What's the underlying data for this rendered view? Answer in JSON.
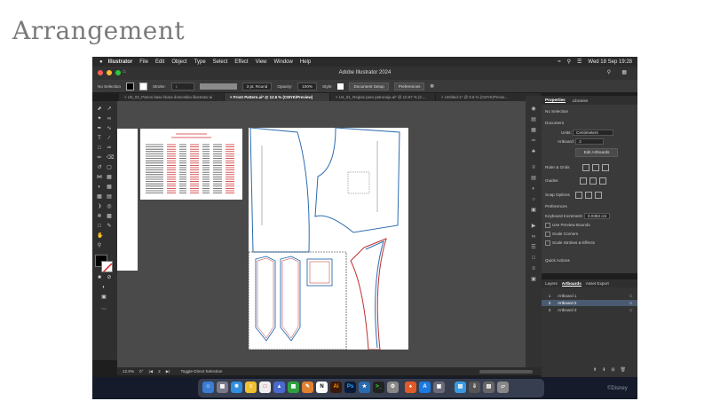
{
  "slide": {
    "title": "Arrangement"
  },
  "menubar": {
    "apple": "",
    "items": [
      "Illustrator",
      "File",
      "Edit",
      "Object",
      "Type",
      "Select",
      "Effect",
      "View",
      "Window",
      "Help"
    ],
    "datetime": "Wed 18 Sep 19:28"
  },
  "window": {
    "title": "Adobe Illustrator 2024"
  },
  "control_bar": {
    "selection": "No Selection",
    "stroke_label": "Stroke:",
    "stroke_value": "3 pt. Round",
    "opacity_label": "Opacity:",
    "opacity_value": "100%",
    "style_label": "Style:",
    "doc_setup": "Document Setup",
    "preferences": "Preferences"
  },
  "tabs": [
    {
      "label": "U5_03_Patron base blusa domestika illustrator.ai"
    },
    {
      "label": "Front Pattern.ai* @ 12.5 % (CMYK/Preview)"
    },
    {
      "label": "U4_01_Reglas para patronaje.ai* @ 10.67 % (C..."
    },
    {
      "label": "Untitled-1* @ 9.6 % (CMYK/Previe..."
    }
  ],
  "statusbar": {
    "zoom": "12.5%",
    "angle": "0°",
    "artboard": "2",
    "status": "Toggle Direct Selection"
  },
  "properties": {
    "tabs": [
      "Properties",
      "Libraries"
    ],
    "no_selection": "No Selection",
    "document": "Document",
    "units_label": "Units:",
    "units_value": "Centimeters",
    "artboard_label": "Artboard:",
    "artboard_value": "2",
    "edit_artboards": "Edit Artboards",
    "rulers_grids": "Ruler & Grids",
    "guides": "Guides",
    "snap_options": "Snap Options",
    "preferences": "Preferences",
    "keyboard_increment_label": "Keyboard Increment:",
    "keyboard_increment_value": "0.0353 cm",
    "use_preview_bounds": "Use Preview Bounds",
    "scale_corners": "Scale Corners",
    "scale_strokes": "Scale Strokes & Effects",
    "quick_actions": "Quick Actions"
  },
  "layers_panel": {
    "tabs": [
      "Layers",
      "Artboards",
      "Asset Export"
    ],
    "artboards": [
      {
        "num": "1",
        "name": "Artboard 1"
      },
      {
        "num": "2",
        "name": "Artboard 2"
      },
      {
        "num": "3",
        "name": "Artboard 3"
      }
    ]
  },
  "dock": {
    "watermark": "©Disney"
  },
  "colors": {
    "pattern_stroke": "#2b6cb0",
    "red_text": "#d03030",
    "accent": "#4a5a70"
  }
}
